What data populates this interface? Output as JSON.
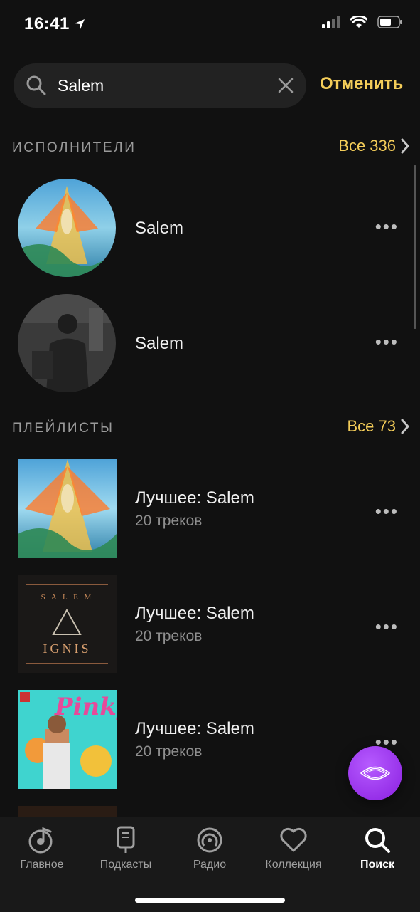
{
  "status_bar": {
    "time": "16:41"
  },
  "search": {
    "value": "Salem",
    "cancel_label": "Отменить"
  },
  "artists_section": {
    "title": "ИСПОЛНИТЕЛИ",
    "see_all": "Все 336"
  },
  "artists": [
    {
      "name": "Salem"
    },
    {
      "name": "Salem"
    }
  ],
  "playlists_section": {
    "title": "ПЛЕЙЛИСТЫ",
    "see_all": "Все 73"
  },
  "playlists": [
    {
      "title": "Лучшее: Salem",
      "subtitle": "20 треков"
    },
    {
      "title": "Лучшее: Salem",
      "subtitle": "20 треков",
      "cover_text_top": "S A L E M",
      "cover_text_bottom": "IGNIS"
    },
    {
      "title": "Лучшее: Salem",
      "subtitle": "20 треков",
      "cover_text": "Pinky"
    }
  ],
  "tabs": [
    {
      "label": "Главное",
      "icon": "note-icon"
    },
    {
      "label": "Подкасты",
      "icon": "microphone-icon"
    },
    {
      "label": "Радио",
      "icon": "radio-icon"
    },
    {
      "label": "Коллекция",
      "icon": "heart-icon"
    },
    {
      "label": "Поиск",
      "icon": "search-icon",
      "active": true
    }
  ],
  "colors": {
    "accent": "#f4cd59",
    "background": "#111111",
    "fab": "#9b30ff"
  }
}
